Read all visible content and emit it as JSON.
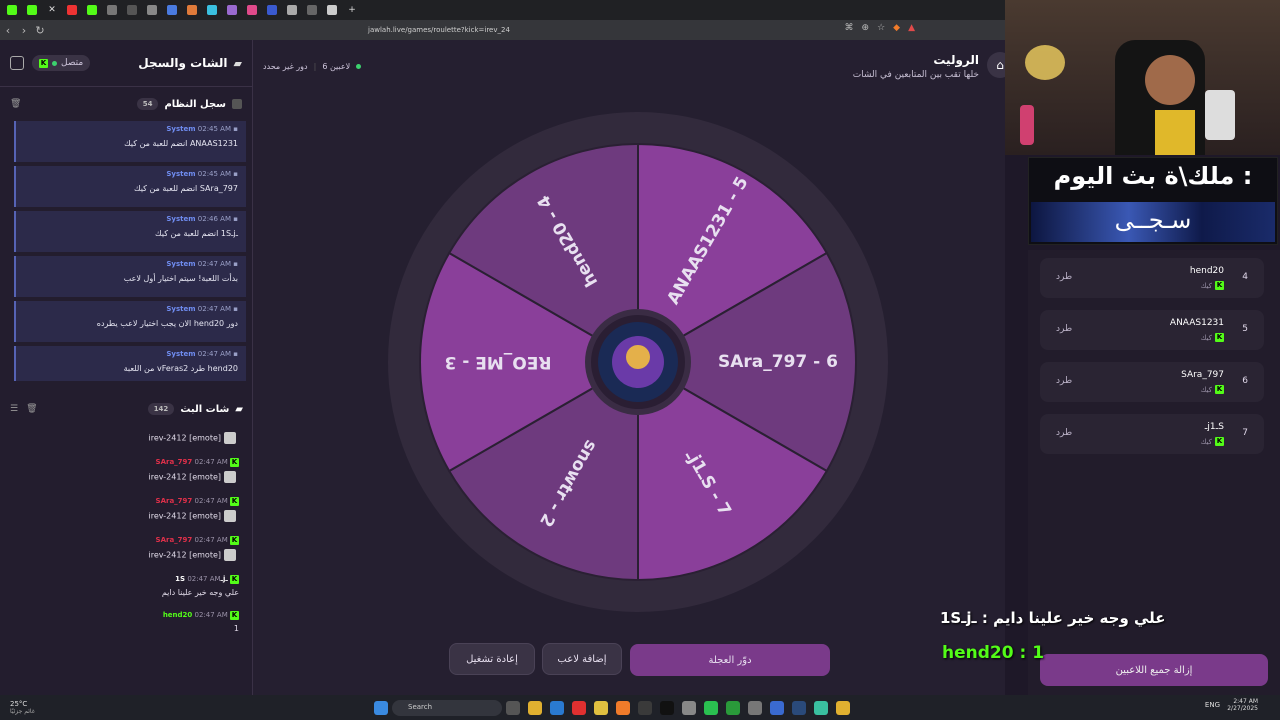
{
  "browser": {
    "url": "jawlah.live/games/roulette?kick=irev_24",
    "tab_icons": [
      "kick",
      "facebook",
      "x",
      "youtube",
      "kick",
      "github",
      "chrome",
      "notion",
      "app",
      "app",
      "app",
      "app",
      "app",
      "app",
      "app",
      "app",
      "app",
      "app",
      "app",
      "app",
      "new-tab"
    ]
  },
  "left": {
    "title": "الشات والسجل",
    "status": "متصل",
    "syslog": {
      "title": "سجل النظام",
      "count": "54",
      "messages": [
        {
          "sender": "System",
          "time": "02:45 AM",
          "text": "ANAAS1231 انضم للعبة من كيك"
        },
        {
          "sender": "System",
          "time": "02:45 AM",
          "text": "SAra_797 انضم للعبة من كيك"
        },
        {
          "sender": "System",
          "time": "02:46 AM",
          "text": "ـjـ1S انضم للعبة من كيك"
        },
        {
          "sender": "System",
          "time": "02:47 AM",
          "text": "بدأت اللعبة! سيتم اختيار أول لاعب"
        },
        {
          "sender": "System",
          "time": "02:47 AM",
          "text": "دور hend20 الان يجب اختيار لاعب يطرده"
        },
        {
          "sender": "System",
          "time": "02:47 AM",
          "text": "hend20 طرد vFeras2 من اللعبة"
        }
      ]
    },
    "chat": {
      "title": "شات البث",
      "count": "142",
      "messages": [
        {
          "user": "",
          "time": "",
          "text": "irev-2412 [emote]",
          "emote": true
        },
        {
          "user": "SAra_797",
          "time": "02:47 AM",
          "color": "#e0304a",
          "text": "irev-2412 [emote]",
          "emote": true
        },
        {
          "user": "SAra_797",
          "time": "02:47 AM",
          "color": "#e0304a",
          "text": "irev-2412 [emote]",
          "emote": true
        },
        {
          "user": "SAra_797",
          "time": "02:47 AM",
          "color": "#e0304a",
          "text": "irev-2412 [emote]",
          "emote": true
        },
        {
          "user": "ـjـ1S",
          "time": "02:47 AM",
          "color": "#ffffff",
          "text": "علي وجه خير علينا دايم",
          "emote": false
        },
        {
          "user": "hend20",
          "time": "02:47 AM",
          "color": "#53fc18",
          "text": "1",
          "emote": false
        }
      ]
    }
  },
  "main": {
    "title": "الروليت",
    "subtitle": "خلها تقب بين المتابعين في الشات",
    "players_count": "6 لاعبين",
    "turn": "دور غير محدد",
    "wheel": {
      "segments": [
        {
          "label": "ANAAS1231 - 5",
          "color": "#8a3f9a"
        },
        {
          "label": "SAra_797 - 6",
          "color": "#6e3a7e"
        },
        {
          "label": "ـjـ1S - 7",
          "color": "#8a3f9a"
        },
        {
          "label": "snowtr - 2",
          "color": "#6e3a7e"
        },
        {
          "label": "REO_ME - 3",
          "color": "#8a3f9a"
        },
        {
          "label": "hend20 - 4",
          "color": "#6e3a7e"
        }
      ]
    },
    "buttons": {
      "spin": "دوّر العجلة",
      "add": "إضافة لاعب",
      "restart": "إعادة تشغيل"
    }
  },
  "overlay": {
    "banner_line1": ": ملك\\ة بث اليوم",
    "banner_line2": "سـجــى",
    "chat_line1": "علي وجه خير علينا دايم : ـjـ1S",
    "chat_line2": "hend20 : 1"
  },
  "players": {
    "items": [
      {
        "num": "4",
        "name": "hend20",
        "source": "كيك",
        "action": "طرد"
      },
      {
        "num": "5",
        "name": "ANAAS1231",
        "source": "كيك",
        "action": "طرد"
      },
      {
        "num": "6",
        "name": "SAra_797",
        "source": "كيك",
        "action": "طرد"
      },
      {
        "num": "7",
        "name": "ـjـ1S",
        "source": "كيك",
        "action": "طرد"
      }
    ],
    "remove_all": "إزالة جميع اللاعبين"
  },
  "taskbar": {
    "weather": "25°C",
    "weather_sub": "غائم جزئيًا",
    "search": "Search",
    "lang": "ENG",
    "time": "2:47 AM",
    "date": "2/27/2025"
  }
}
